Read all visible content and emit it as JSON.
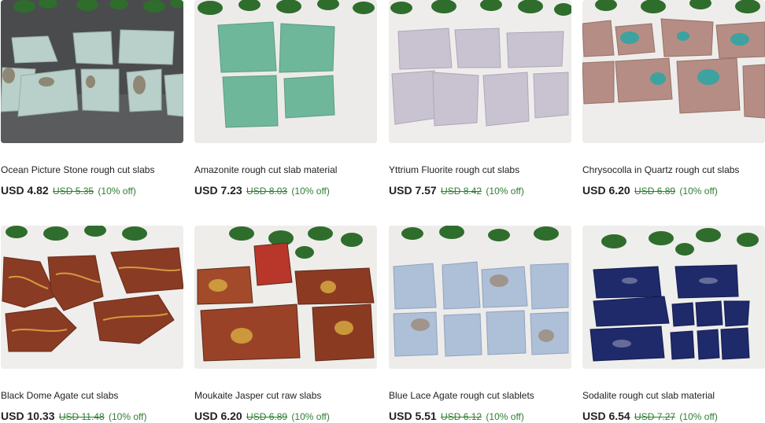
{
  "colors": {
    "sale_green": "#2f7d32",
    "text": "#222222",
    "background": "#ffffff"
  },
  "listings": [
    {
      "title": "Ocean Picture Stone rough cut slabs",
      "price": "USD 4.82",
      "original_price": "USD 5.35",
      "discount": "(10% off)",
      "image": "ocean-picture-stone-slabs-photo"
    },
    {
      "title": "Amazonite rough cut slab material",
      "price": "USD 7.23",
      "original_price": "USD 8.03",
      "discount": "(10% off)",
      "image": "amazonite-slabs-photo"
    },
    {
      "title": "Yttrium Fluorite rough cut slabs",
      "price": "USD 7.57",
      "original_price": "USD 8.42",
      "discount": "(10% off)",
      "image": "yttrium-fluorite-slabs-photo"
    },
    {
      "title": "Chrysocolla in Quartz rough cut slabs",
      "price": "USD 6.20",
      "original_price": "USD 6.89",
      "discount": "(10% off)",
      "image": "chrysocolla-quartz-slabs-photo"
    },
    {
      "title": "Black Dome Agate cut slabs",
      "price": "USD 10.33",
      "original_price": "USD 11.48",
      "discount": "(10% off)",
      "image": "black-dome-agate-slabs-photo"
    },
    {
      "title": "Moukaite Jasper cut raw slabs",
      "price": "USD 6.20",
      "original_price": "USD 6.89",
      "discount": "(10% off)",
      "image": "moukaite-jasper-slabs-photo"
    },
    {
      "title": "Blue Lace Agate rough cut slablets",
      "price": "USD 5.51",
      "original_price": "USD 6.12",
      "discount": "(10% off)",
      "image": "blue-lace-agate-slablets-photo"
    },
    {
      "title": "Sodalite rough cut slab material",
      "price": "USD 6.54",
      "original_price": "USD 7.27",
      "discount": "(10% off)",
      "image": "sodalite-slabs-photo"
    }
  ]
}
